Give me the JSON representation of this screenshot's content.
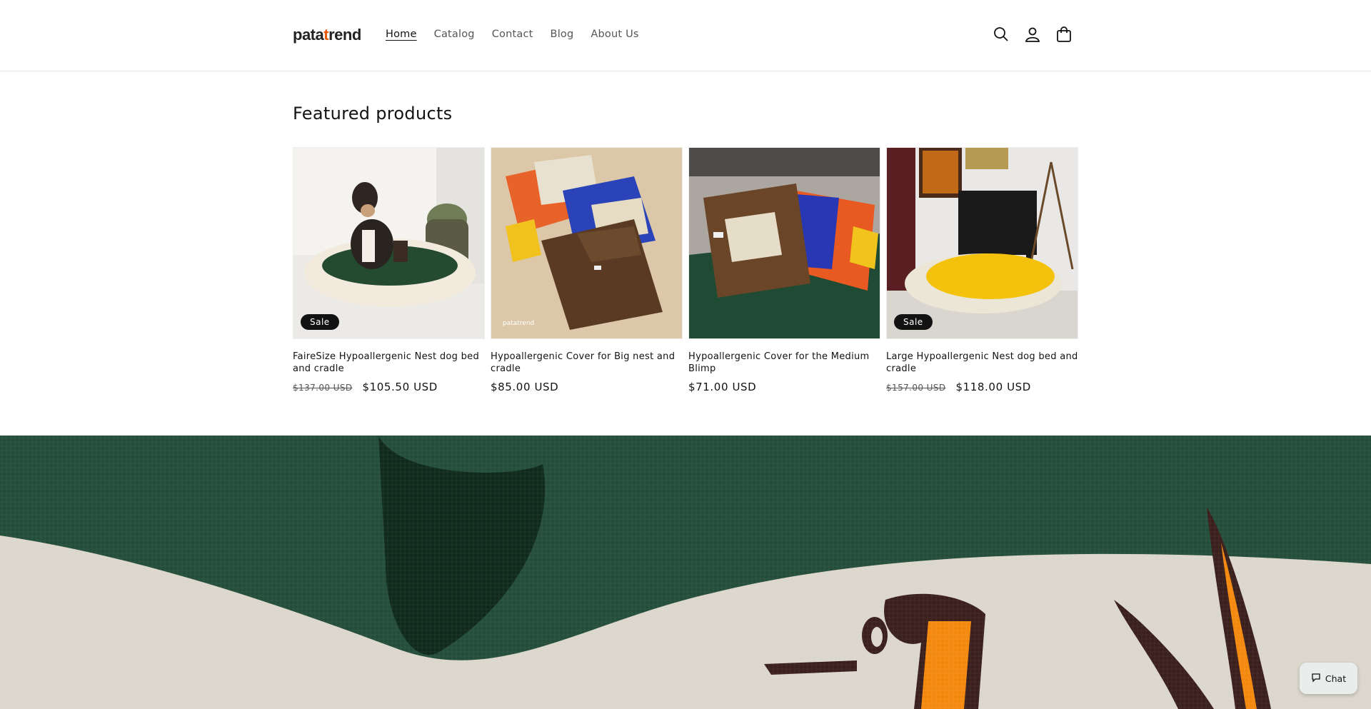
{
  "header": {
    "logo_prefix": "pata",
    "logo_accent": "t",
    "logo_suffix": "rend",
    "nav": [
      {
        "label": "Home",
        "active": true
      },
      {
        "label": "Catalog"
      },
      {
        "label": "Contact"
      },
      {
        "label": "Blog"
      },
      {
        "label": "About Us"
      }
    ],
    "icons": [
      "search-icon",
      "account-icon",
      "cart-icon"
    ]
  },
  "featured": {
    "title": "Featured products",
    "products": [
      {
        "title": "FaireSize Hypoallergenic Nest dog bed and cradle",
        "old_price": "$137.00 USD",
        "price": "$105.50 USD",
        "badge": "Sale"
      },
      {
        "title": "Hypoallergenic Cover for Big nest and cradle",
        "old_price": "",
        "price": "$85.00 USD",
        "badge": "",
        "watermark": "patatrend"
      },
      {
        "title": "Hypoallergenic Cover for the Medium Blimp",
        "old_price": "",
        "price": "$71.00 USD",
        "badge": ""
      },
      {
        "title": "Large Hypoallergenic Nest dog bed and cradle",
        "old_price": "$157.00 USD",
        "price": "$118.00 USD",
        "badge": "Sale"
      }
    ]
  },
  "chat": {
    "label": "Chat"
  },
  "colors": {
    "accent": "#e8590c",
    "green": "#1f4a33",
    "badge": "#121212"
  }
}
